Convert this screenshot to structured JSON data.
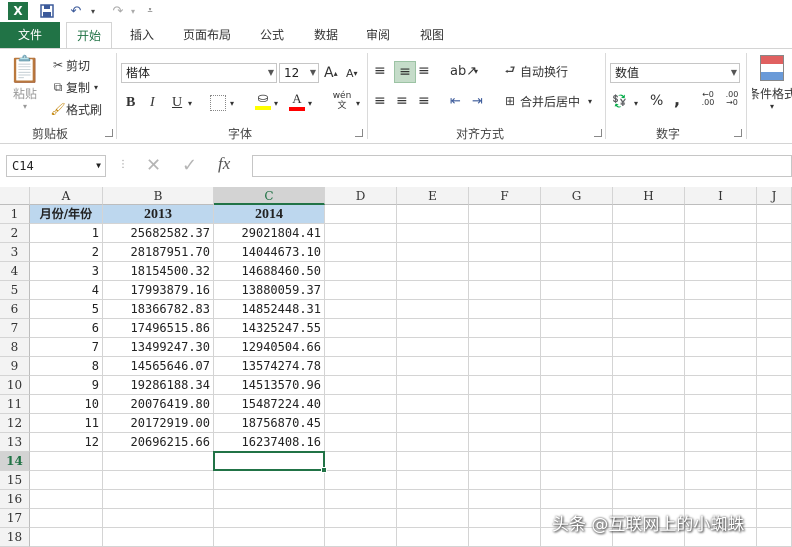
{
  "quick_access": {
    "icons": [
      "excel-icon",
      "save-icon",
      "undo-icon",
      "redo-icon",
      "customize-icon"
    ]
  },
  "tabs": [
    "文件",
    "开始",
    "插入",
    "页面布局",
    "公式",
    "数据",
    "审阅",
    "视图"
  ],
  "active_tab": "开始",
  "ribbon": {
    "clipboard": {
      "paste": "粘贴",
      "cut": "剪切",
      "copy": "复制",
      "format_painter": "格式刷",
      "label": "剪贴板"
    },
    "font": {
      "font_name": "楷体",
      "font_size": "12",
      "bold": "B",
      "italic": "I",
      "underline": "U",
      "phonetic": "wén",
      "label": "字体"
    },
    "alignment": {
      "wrap_text": "自动换行",
      "merge_center": "合并后居中",
      "label": "对齐方式"
    },
    "number": {
      "format": "数值",
      "percent": "%",
      "comma": ",",
      "label": "数字"
    },
    "styles": {
      "conditional": "条件格式"
    }
  },
  "formula_bar": {
    "name_box": "C14",
    "fx": "fx",
    "value": ""
  },
  "columns": [
    "A",
    "B",
    "C",
    "D",
    "E",
    "F",
    "G",
    "H",
    "I",
    "J"
  ],
  "header_row": [
    "月份/年份",
    "2013",
    "2014"
  ],
  "rows": [
    [
      "1",
      "25682582.37",
      "29021804.41"
    ],
    [
      "2",
      "28187951.70",
      "14044673.10"
    ],
    [
      "3",
      "18154500.32",
      "14688460.50"
    ],
    [
      "4",
      "17993879.16",
      "13880059.37"
    ],
    [
      "5",
      "18366782.83",
      "14852448.31"
    ],
    [
      "6",
      "17496515.86",
      "14325247.55"
    ],
    [
      "7",
      "13499247.30",
      "12940504.66"
    ],
    [
      "8",
      "14565646.07",
      "13574274.78"
    ],
    [
      "9",
      "19286188.34",
      "14513570.96"
    ],
    [
      "10",
      "20076419.80",
      "15487224.40"
    ],
    [
      "11",
      "20172919.00",
      "18756870.45"
    ],
    [
      "12",
      "20696215.66",
      "16237408.16"
    ]
  ],
  "row_numbers": [
    "1",
    "2",
    "3",
    "4",
    "5",
    "6",
    "7",
    "8",
    "9",
    "10",
    "11",
    "12",
    "13",
    "14",
    "15",
    "16",
    "17",
    "18"
  ],
  "selected_cell": "C14",
  "watermark": "头条 @互联网上的小蜘蛛",
  "colors": {
    "accent": "#217346",
    "header_fill": "#bdd7ee"
  }
}
